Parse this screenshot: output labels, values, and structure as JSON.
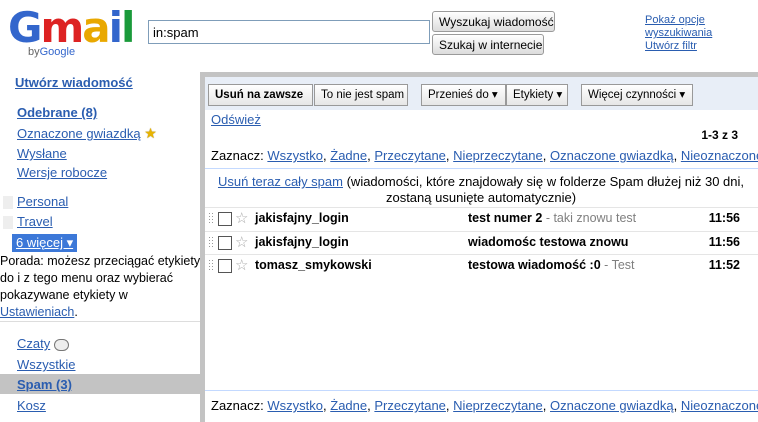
{
  "logo": {
    "word": "Gmail",
    "by_prefix": "by",
    "by_brand": "Google"
  },
  "search": {
    "value": "in:spam",
    "mail_button": "Wyszukaj wiadomość",
    "web_button": "Szukaj w internecie"
  },
  "top_links": [
    "Pokaż opcje",
    "wyszukiwania",
    "Utwórz filtr"
  ],
  "sidebar": {
    "compose": "Utwórz wiadomość",
    "inbox": "Odebrane (8)",
    "starred": "Oznaczone gwiazdką",
    "sent": "Wysłane",
    "drafts": "Wersje robocze",
    "labels": [
      "Personal",
      "Travel"
    ],
    "more_labels": "6 więcej ▾",
    "tip": "Porada: możesz przeciągać etykiety do i z tego menu oraz wybierać pokazywane etykiety w",
    "tip_link": "Ustawieniach",
    "tip_end": ".",
    "chats": "Czaty",
    "all": "Wszystkie",
    "spam": "Spam (3)",
    "trash": "Kosz"
  },
  "toolbar": {
    "delete": "Usuń na zawsze",
    "not_spam": "To nie jest spam",
    "move": "Przenieś do ▾",
    "labels": "Etykiety ▾",
    "more": "Więcej czynności ▾"
  },
  "refresh": "Odśwież",
  "count": "1-3 z 3",
  "select": {
    "label": "Zaznacz:",
    "options": [
      "Wszystko",
      "Żadne",
      "Przeczytane",
      "Nieprzeczytane",
      "Oznaczone gwiazdką",
      "Nieoznaczone"
    ],
    "sep": ","
  },
  "notice": {
    "link": "Usuń teraz cały spam",
    "text": " (wiadomości, które znajdowały się w folderze Spam dłużej niż 30 dni, zostaną usunięte automatycznie)"
  },
  "messages": [
    {
      "from": "jakisfajny_login",
      "subject": "test numer 2",
      "snippet": " - taki znowu test",
      "time": "11:56"
    },
    {
      "from": "jakisfajny_login",
      "subject": "wiadomośc testowa znowu",
      "snippet": "",
      "time": "11:56"
    },
    {
      "from": "tomasz_smykowski",
      "subject": "testowa wiadomość :0",
      "snippet": " - Test",
      "time": "11:52"
    }
  ],
  "colors": {
    "selected_nav": "#c3c3c3",
    "panel_border": "#c3c3c3",
    "link": "#2a5db0"
  },
  "icons": {
    "star": "star-icon",
    "chat": "chat-bubble-icon",
    "starred": "gold-star-icon"
  }
}
